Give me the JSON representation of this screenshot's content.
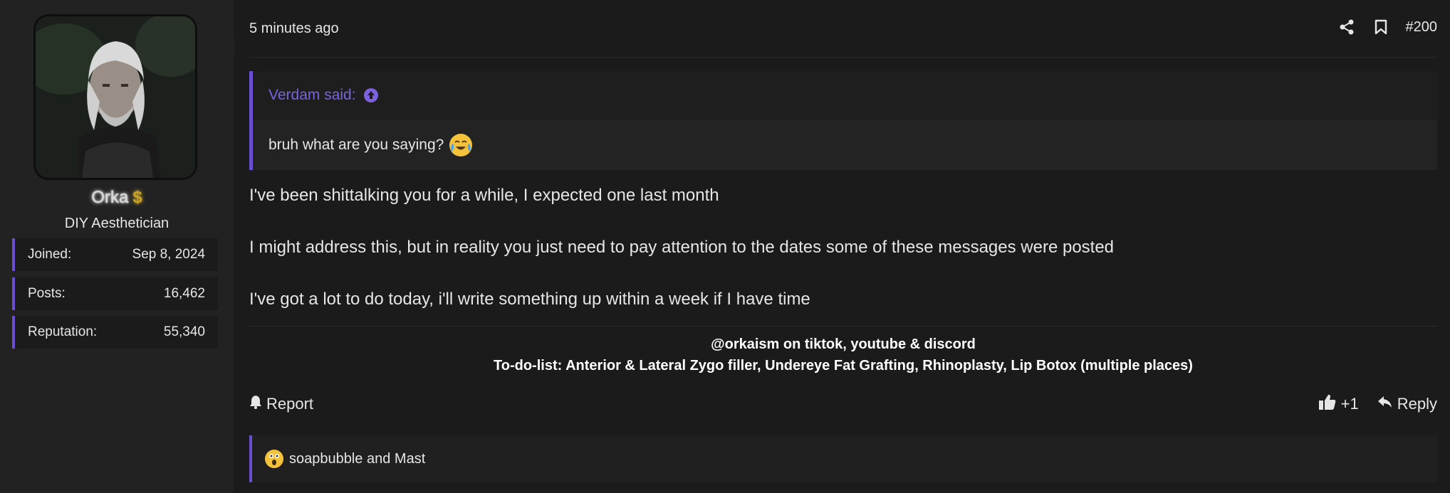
{
  "user": {
    "name": "Orka",
    "badge_symbol": "$",
    "title": "DIY Aesthetician",
    "stats": [
      {
        "label": "Joined:",
        "value": "Sep 8, 2024"
      },
      {
        "label": "Posts:",
        "value": "16,462"
      },
      {
        "label": "Reputation:",
        "value": "55,340"
      }
    ]
  },
  "post": {
    "timestamp": "5 minutes ago",
    "number": "#200",
    "quote": {
      "author": "Verdam said:",
      "text": "bruh what are you saying?"
    },
    "message": [
      "I've been shittalking you for a while, I expected one last month",
      "I might address this, but in reality you just need to pay attention to the dates some of these messages were posted",
      "I've got a lot to do today, i'll write something up within a week if I have time"
    ],
    "signature": [
      "@orkaism on tiktok, youtube & discord",
      "To-do-list: Anterior & Lateral Zygo filler, Undereye Fat Grafting, Rhinoplasty, Lip Botox (multiple places)"
    ],
    "actions": {
      "report": "Report",
      "reaction_count": "+1",
      "reply": "Reply"
    },
    "reactions_text": "soapbubble and Mast"
  },
  "colors": {
    "accent": "#6a4fd0",
    "quote_author": "#7c62df",
    "background": "#1b1b1b",
    "sidebar": "#222222"
  }
}
